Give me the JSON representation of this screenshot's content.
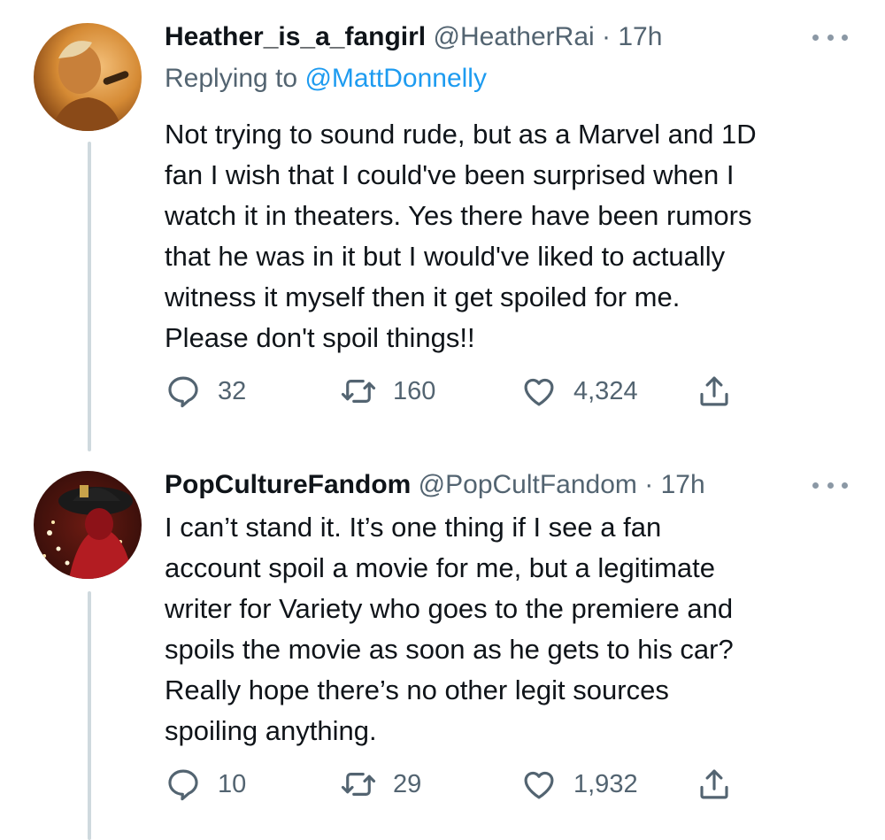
{
  "tweets": [
    {
      "display_name": "Heather_is_a_fangirl",
      "handle": "@HeatherRai",
      "separator": "·",
      "time": "17h",
      "reply_prefix": "Replying to ",
      "reply_mention": "@MattDonnelly",
      "text": "Not trying to sound rude, but as a Marvel and 1D\nfan I wish that I could've been surprised when I\nwatch it in theaters. Yes there have been rumors\nthat he was in it but I would've liked to actually\nwitness it myself then it get spoiled for me.\nPlease don't spoil things!!",
      "replies": "32",
      "retweets": "160",
      "likes": "4,324"
    },
    {
      "display_name": "PopCultureFandom",
      "handle": "@PopCultFandom",
      "separator": "·",
      "time": "17h",
      "text": "I can’t stand it. It’s one thing if I see a fan\naccount spoil a movie for me, but a legitimate\nwriter for Variety who goes to the premiere and\nspoils the movie as soon as he gets to his car?\nReally hope there’s no other legit sources\nspoiling anything.",
      "replies": "10",
      "retweets": "29",
      "likes": "1,932"
    }
  ],
  "icons": {
    "reply": "speech-bubble-icon",
    "retweet": "retweet-icon",
    "like": "heart-icon",
    "share": "share-icon",
    "more": "more-dots-icon"
  },
  "colors": {
    "text": "#0f1419",
    "secondary": "#536471",
    "link": "#1d9bf0",
    "thread_line": "#cfd9de"
  }
}
